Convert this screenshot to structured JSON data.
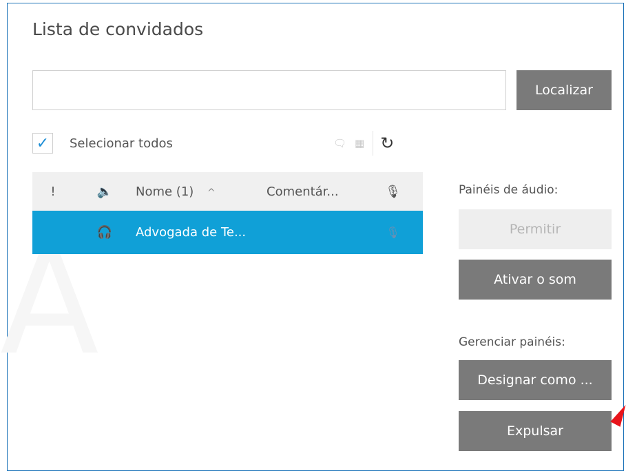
{
  "title": "Lista de convidados",
  "search": {
    "value": "",
    "placeholder": ""
  },
  "buttons": {
    "find": "Localizar",
    "allow": "Permitir",
    "unmute": "Ativar o som",
    "assign": "Designar como ...",
    "expel": "Expulsar"
  },
  "select_all": {
    "label": "Selecionar todos",
    "checked": true
  },
  "table": {
    "headers": {
      "flag": "!",
      "audio": "🔈",
      "name": "Nome (1)",
      "comment": "Comentár...",
      "mic": "🎙"
    },
    "rows": [
      {
        "audio": "🎧",
        "name": "Advogada de Te...",
        "comment": "",
        "mic": "🎙"
      }
    ]
  },
  "panels": {
    "audio_label": "Painéis de áudio:",
    "manage_label": "Gerenciar painéis:"
  },
  "background_mark": "A",
  "colors": {
    "accent": "#10a0d7",
    "button": "#7a7a7a",
    "frame": "#1b73b8",
    "annotation": "#e8141b"
  }
}
